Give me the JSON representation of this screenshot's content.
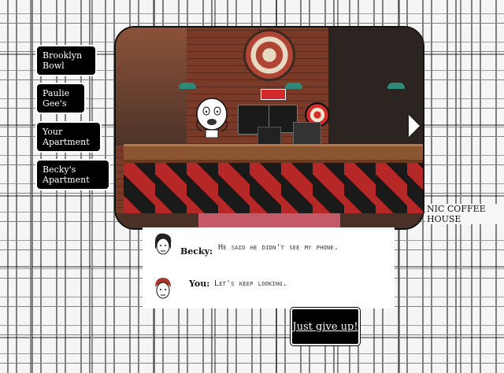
{
  "nav": {
    "items": [
      {
        "label": "Brooklyn Bowl"
      },
      {
        "label": "Paulie Gee's"
      },
      {
        "label": "Your Apartment"
      },
      {
        "label": "Becky's Apartment"
      }
    ]
  },
  "scene": {
    "next_icon": "chevron-right-icon"
  },
  "dialog": {
    "lines": [
      {
        "speaker": "Becky:",
        "text": "He said he didn't see my phone."
      },
      {
        "speaker": "You:",
        "text": "Let's keep looking."
      }
    ]
  },
  "actions": {
    "give_up_label": "Just give up!"
  },
  "background": {
    "sign_text": "NIC COFFEE HOUSE"
  },
  "colors": {
    "button_bg": "#000000",
    "button_text": "#ffffff",
    "counter_red": "#b62727"
  }
}
